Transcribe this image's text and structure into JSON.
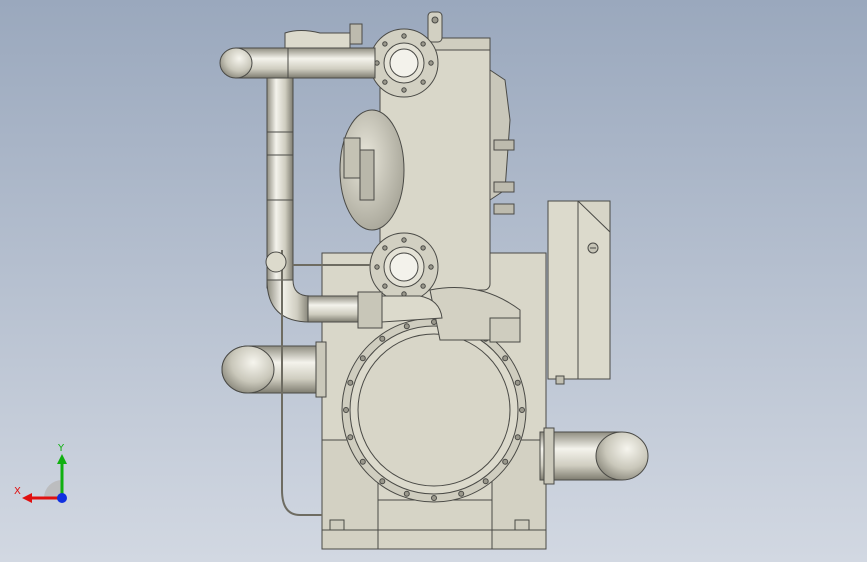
{
  "viewport": {
    "background_top": "#9aa8bd",
    "background_bottom": "#d2d8e2"
  },
  "model": {
    "body_color": "#d9d7c9",
    "body_shade": "#c8c6b6",
    "pipe_light": "#f4f3ec",
    "pipe_dark": "#8f8d80",
    "outline_color": "#4a4a46"
  },
  "triad": {
    "x_label": "X",
    "y_label": "Y",
    "x_color": "#e01010",
    "y_color": "#10b010",
    "z_color": "#1030e0"
  }
}
